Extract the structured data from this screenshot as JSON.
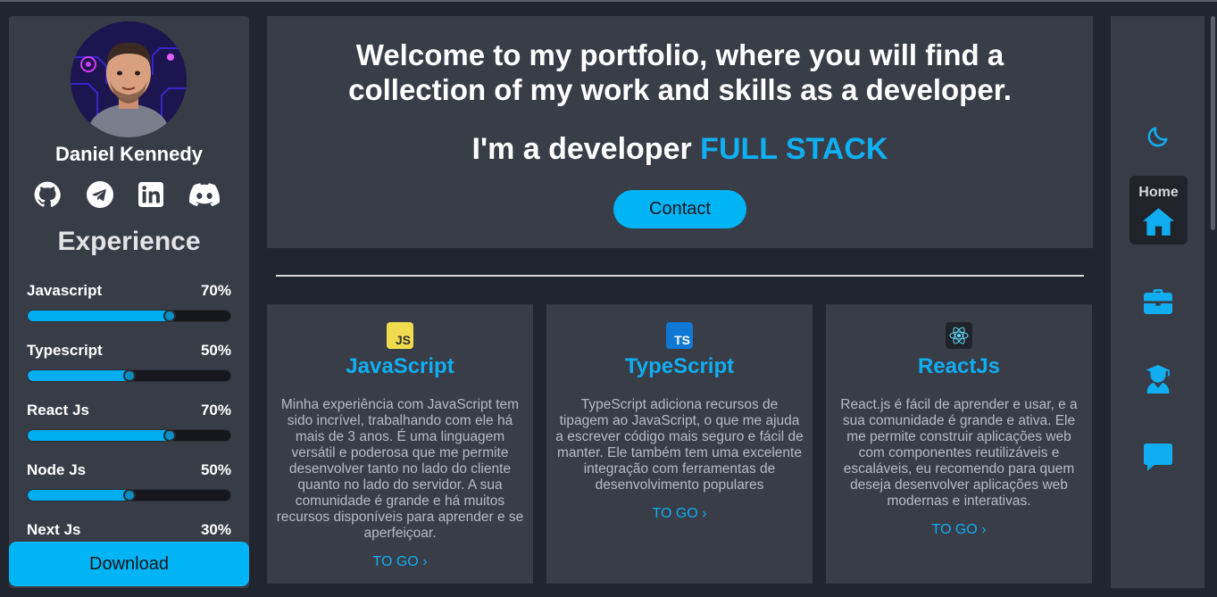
{
  "profile": {
    "name": "Daniel Kennedy",
    "socials": [
      "github-icon",
      "telegram-icon",
      "linkedin-icon",
      "discord-icon"
    ]
  },
  "experience": {
    "title": "Experience",
    "skills": [
      {
        "name": "Javascript",
        "percent_label": "70%",
        "level": 0.7
      },
      {
        "name": "Typescript",
        "percent_label": "50%",
        "level": 0.5
      },
      {
        "name": "React Js",
        "percent_label": "70%",
        "level": 0.7
      },
      {
        "name": "Node Js",
        "percent_label": "50%",
        "level": 0.5
      },
      {
        "name": "Next Js",
        "percent_label": "30%",
        "level": 0.3
      }
    ],
    "download_label": "Download"
  },
  "hero": {
    "title": "Welcome to my portfolio, where you will find a collection of my work and skills as a developer.",
    "subtitle_prefix": "I'm a developer ",
    "subtitle_accent": "FULL STACK",
    "contact_label": "Contact"
  },
  "cards": [
    {
      "title": "JavaScript",
      "icon_text": "JS",
      "icon": "javascript-icon",
      "text": "Minha experiência com JavaScript tem sido incrível, trabalhando com ele há mais de 3 anos. É uma linguagem versátil e poderosa que me permite desenvolver tanto no lado do cliente quanto no lado do servidor. A sua comunidade é grande e há muitos recursos disponíveis para aprender e se aperfeiçoar.",
      "link": "TO GO"
    },
    {
      "title": "TypeScript",
      "icon_text": "TS",
      "icon": "typescript-icon",
      "text": "TypeScript adiciona recursos de tipagem ao JavaScript, o que me ajuda a escrever código mais seguro e fácil de manter. Ele também tem uma excelente integração com ferramentas de desenvolvimento populares",
      "link": "TO GO"
    },
    {
      "title": "ReactJs",
      "icon_text": "",
      "icon": "react-icon",
      "text": "React.js é fácil de aprender e usar, e a sua comunidade é grande e ativa. Ele me permite construir aplicações web com componentes reutilizáveis e escaláveis, eu recomendo para quem deseja desenvolver aplicações web modernas e interativas.",
      "link": "TO GO"
    }
  ],
  "nav": {
    "home_label": "Home",
    "icons": [
      "moon-icon",
      "home-icon",
      "briefcase-icon",
      "graduate-icon",
      "chat-icon"
    ]
  },
  "colors": {
    "accent": "#00b4f5",
    "panel": "#393d48",
    "background": "#21252e"
  }
}
